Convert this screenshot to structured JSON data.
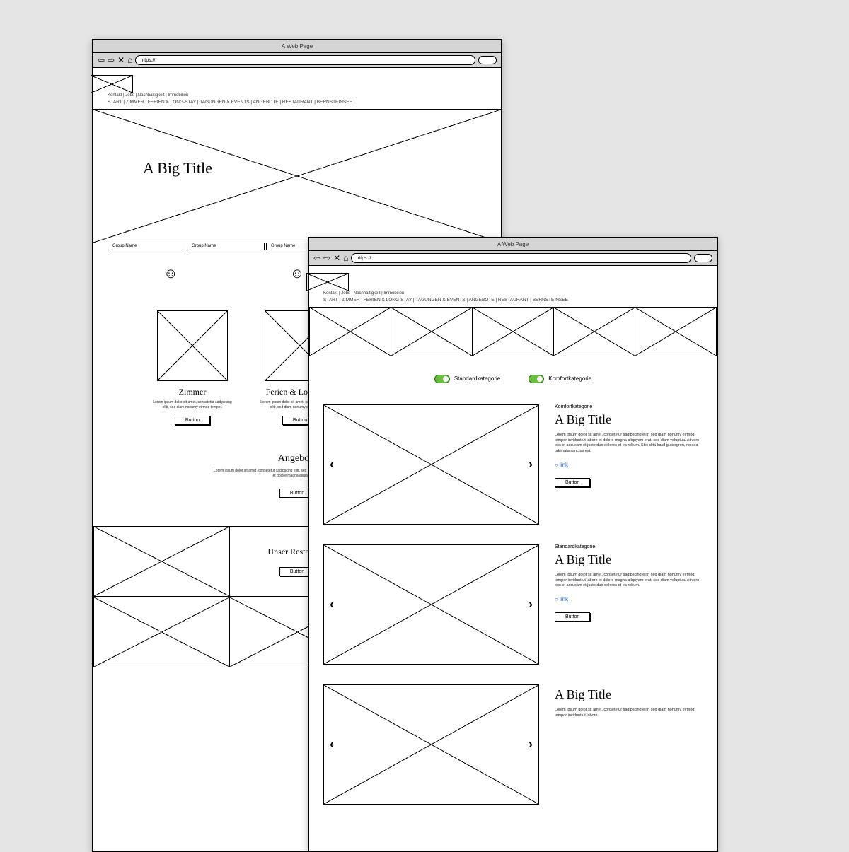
{
  "browser": {
    "page_title": "A Web Page",
    "url": "https://"
  },
  "header": {
    "top_links": [
      "Kontakt",
      "Jobs",
      "Nachhaltigkeit",
      "Immobilien"
    ],
    "nav": [
      "START",
      "ZIMMER",
      "FERIEN & LONG-STAY",
      "TAGUNGEN & EVENTS",
      "ANGEBOTE",
      "RESTAURANT",
      "BERNSTEINSEE"
    ]
  },
  "window_a": {
    "hero_title": "A Big Title",
    "tabs": [
      "Group Name",
      "Group Name",
      "Group Name"
    ],
    "categories": [
      {
        "title": "Zimmer",
        "desc": "Lorem ipsum dolor sit amet, consetetur sadipscing elitr, sed diam nonumy eirmod tempor.",
        "button": "Button"
      },
      {
        "title": "Ferien & Long-Stay",
        "desc": "Lorem ipsum dolor sit amet, consetetur sadipscing elitr, sed diam nonumy eirmod tempor.",
        "button": "Button"
      }
    ],
    "offers": {
      "title": "Angebote",
      "desc": "Lorem ipsum dolor sit amet, consetetur sadipscing elitr, sed diam nonumy eirmod tempor invidunt ut labore et dolore magna aliquyam erat.",
      "button": "Button"
    },
    "restaurant": {
      "title": "Unser Restaurant",
      "button": "Button"
    }
  },
  "window_b": {
    "toggles": [
      {
        "label": "Standardkategorie"
      },
      {
        "label": "Komfortkategorie"
      }
    ],
    "rooms": [
      {
        "category": "Komfortkategorie",
        "title": "A Big Title",
        "desc": "Lorem ipsum dolor sit amet, consetetur sadipscing elitr, sed diam nonumy eirmod tempor invidunt ut labore et dolore magna aliquyam erat, sed diam voluptua. At vero eos et accusam et justo duo dolores et ea rebum. Stet clita kasd gubergren, no sea takimata sanctus est.",
        "link": "○ link",
        "button": "Button"
      },
      {
        "category": "Standardkategorie",
        "title": "A Big Title",
        "desc": "Lorem ipsum dolor sit amet, consetetur sadipscing elitr, sed diam nonumy eirmod tempor invidunt ut labore et dolore magna aliquyam erat, sed diam voluptua. At vero eos et accusam et justo duo dolores et ea rebum.",
        "link": "○ link",
        "button": "Button"
      },
      {
        "category": "",
        "title": "A Big Title",
        "desc": "Lorem ipsum dolor sit amet, consetetur sadipscing elitr, sed diam nonumy eirmod tempor invidunt ut labore.",
        "link": "",
        "button": ""
      }
    ]
  }
}
